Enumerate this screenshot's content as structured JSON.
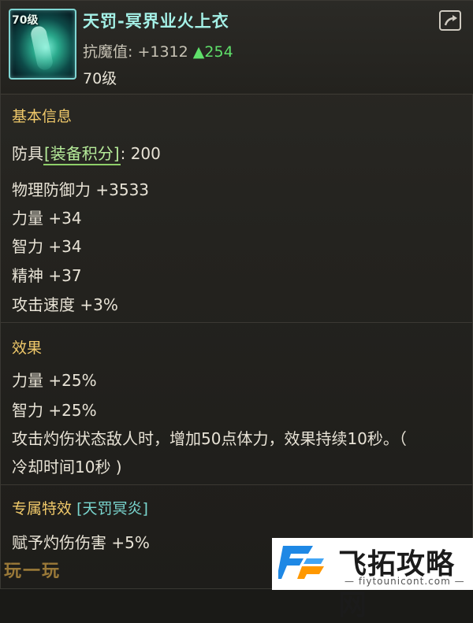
{
  "item": {
    "icon_level": "70级",
    "name": "天罚-冥界业火上衣",
    "stat_label": "抗魔值:",
    "stat_value": "+1312",
    "stat_up_arrow": "▲",
    "stat_up_value": "254",
    "level": "70级"
  },
  "basic": {
    "title": "基本信息",
    "armor_prefix": "防具",
    "score_tag": "[装备积分]",
    "score_value": ": 200",
    "lines": [
      "物理防御力 +3533",
      "力量 +34",
      "智力 +34",
      "精神 +37",
      "攻击速度 +3%"
    ]
  },
  "effects": {
    "title": "效果",
    "lines": [
      "力量 +25%",
      "智力 +25%",
      "攻击灼伤状态敌人时，增加50点体力，效果持续10秒。（",
      "冷却时间10秒 )"
    ]
  },
  "exclusive": {
    "title": "专属特效",
    "tag": "[天罚冥炎]",
    "lines": [
      "赋予灼伤伤害 +5%"
    ]
  },
  "watermark": {
    "left": "玩一玩",
    "brand_name": "飞拓攻略网",
    "brand_url": "— fiytounicont.com —"
  },
  "colors": {
    "item_name": "#a4f0e6",
    "section_title": "#f0c96a",
    "stat_up": "#5fe06a",
    "score_tag": "#b6ec9a"
  },
  "icons": {
    "share": "share-export-icon",
    "item": "armor-item-icon",
    "brand": "fp-logo-icon"
  }
}
